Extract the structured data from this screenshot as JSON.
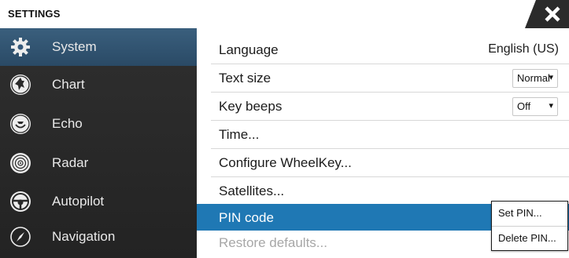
{
  "window": {
    "title": "SETTINGS"
  },
  "sidebar": {
    "items": [
      {
        "label": "System",
        "icon": "gear-icon",
        "selected": true
      },
      {
        "label": "Chart",
        "icon": "chart-icon",
        "selected": false
      },
      {
        "label": "Echo",
        "icon": "echo-icon",
        "selected": false
      },
      {
        "label": "Radar",
        "icon": "radar-icon",
        "selected": false
      },
      {
        "label": "Autopilot",
        "icon": "steering-wheel-icon",
        "selected": false
      },
      {
        "label": "Navigation",
        "icon": "compass-icon",
        "selected": false
      }
    ]
  },
  "settings": {
    "rows": [
      {
        "label": "Language",
        "value": "English (US)"
      },
      {
        "label": "Text size",
        "dropdown": "Normal"
      },
      {
        "label": "Key beeps",
        "dropdown": "Off"
      },
      {
        "label": "Time..."
      },
      {
        "label": "Configure WheelKey..."
      },
      {
        "label": "Satellites..."
      },
      {
        "label": "PIN code"
      },
      {
        "label": "Restore defaults..."
      }
    ]
  },
  "popup": {
    "items": [
      {
        "label": "Set PIN..."
      },
      {
        "label": "Delete PIN..."
      }
    ]
  },
  "dropdown_caret": "▾",
  "colors": {
    "accent": "#1f78b4",
    "sidebar_bg": "#2a2a2a",
    "sidebar_selected": "#335777"
  }
}
